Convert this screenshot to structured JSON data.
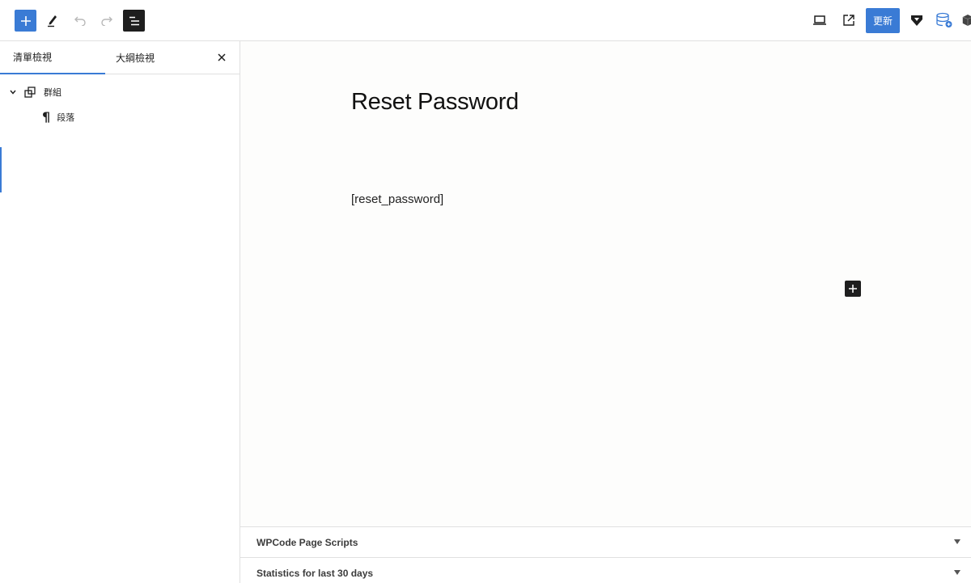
{
  "toolbar": {
    "add_block_icon": "plus-icon",
    "tools_icon": "pencil-icon",
    "undo_icon": "undo-icon",
    "redo_icon": "redo-icon",
    "list_view_icon": "list-view-icon",
    "preview_icon": "laptop-icon",
    "view_post_icon": "external-link-icon",
    "update_label": "更新",
    "plugin_icons": [
      "shield-g-icon",
      "database-icon",
      "plugin-cube-icon"
    ],
    "accent_color": "#3a7bd5"
  },
  "sidebar": {
    "tabs": [
      {
        "label": "清單檢視",
        "active": true
      },
      {
        "label": "大綱檢視",
        "active": false
      }
    ],
    "close_icon": "close-icon",
    "tree": [
      {
        "label": "群組",
        "icon": "group-icon",
        "expanded": true,
        "level": 1
      },
      {
        "label": "段落",
        "icon": "paragraph-icon",
        "level": 2
      }
    ]
  },
  "canvas": {
    "title": "Reset Password",
    "content": "[reset_password]",
    "inserter_icon": "plus-icon"
  },
  "metaboxes": [
    {
      "title": "WPCode Page Scripts",
      "icon": "triangle-down-icon"
    },
    {
      "title": "Statistics for last 30 days",
      "icon": "triangle-down-icon"
    }
  ]
}
